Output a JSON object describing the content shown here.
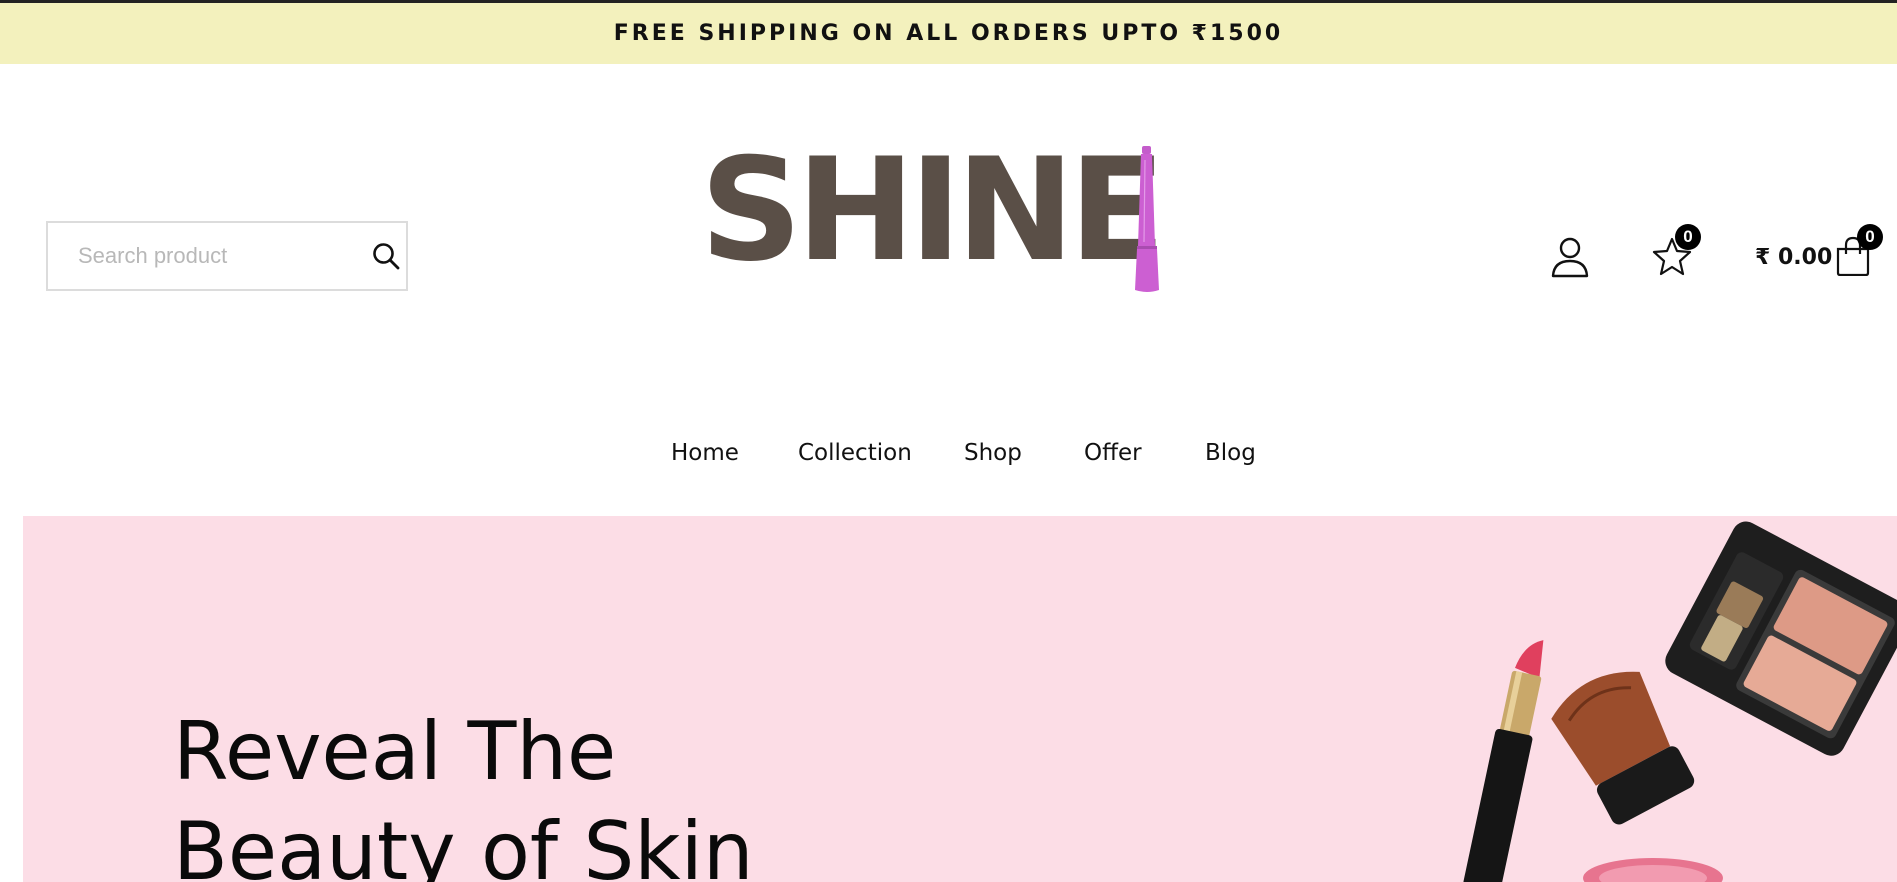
{
  "announcement": {
    "text": "FREE SHIPPING ON ALL ORDERS UPTO ₹1500"
  },
  "search": {
    "placeholder": "Search product",
    "value": ""
  },
  "brand": {
    "name": "SHINE",
    "color": "#5a4f47",
    "accent": "#cc5fd2"
  },
  "header": {
    "account_icon": "user-icon",
    "wishlist": {
      "icon": "star-icon",
      "count": "0"
    },
    "cart": {
      "icon": "shopping-bag-icon",
      "total": "₹ 0.00",
      "count": "0"
    }
  },
  "nav": {
    "items": [
      {
        "label": "Home"
      },
      {
        "label": "Collection"
      },
      {
        "label": "Shop"
      },
      {
        "label": "Offer"
      },
      {
        "label": "Blog"
      }
    ]
  },
  "hero": {
    "title_line1": "Reveal The",
    "title_line2": "Beauty of Skin",
    "background": "#fcdde6"
  }
}
